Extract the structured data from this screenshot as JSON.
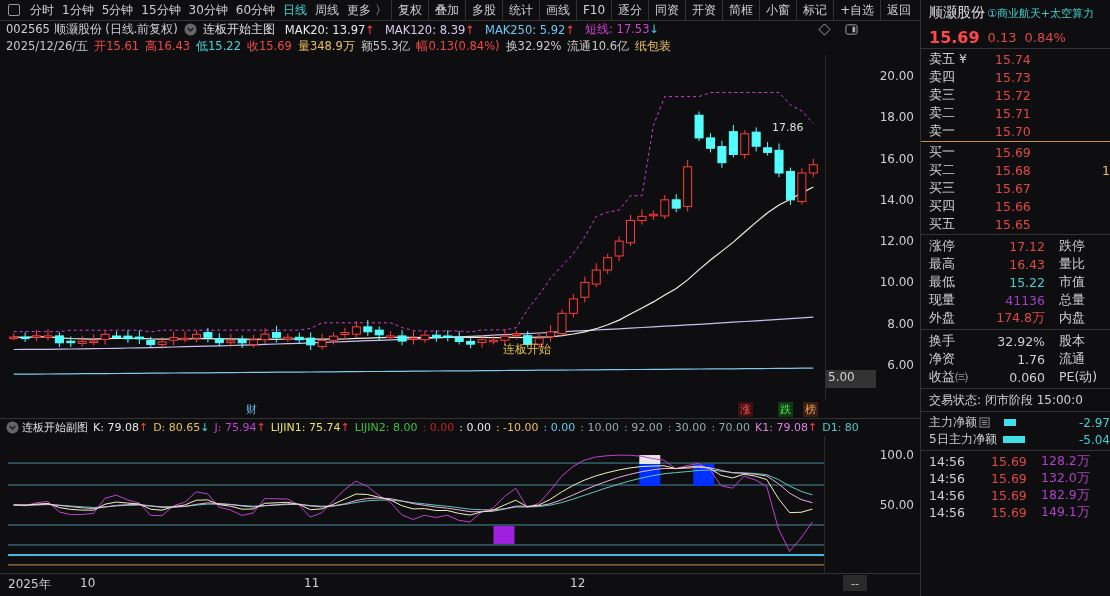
{
  "toolbar": {
    "periods": [
      {
        "label": "分时",
        "selected": false
      },
      {
        "label": "1分钟",
        "selected": false
      },
      {
        "label": "5分钟",
        "selected": false
      },
      {
        "label": "15分钟",
        "selected": false
      },
      {
        "label": "30分钟",
        "selected": false
      },
      {
        "label": "60分钟",
        "selected": false
      },
      {
        "label": "日线",
        "selected": true
      },
      {
        "label": "周线",
        "selected": false
      },
      {
        "label": "更多 〉",
        "selected": false
      }
    ],
    "buttons": [
      "复权",
      "叠加",
      "多股",
      "统计",
      "画线",
      "F10",
      "逐分",
      "同资",
      "开资",
      "简框",
      "小窗",
      "标记",
      "+自选",
      "返回"
    ]
  },
  "main_header": {
    "stock": "002565 顺灏股份 (日线.前复权)",
    "indicator": "连板开始主图",
    "values": [
      {
        "text": "MAK20: 13.97",
        "arrow": "↑",
        "color": "#e8e8e8"
      },
      {
        "text": "MAK120: 8.39",
        "arrow": "↑",
        "color": "#d8c8f0"
      },
      {
        "text": "MAK250: 5.92",
        "arrow": "↑",
        "color": "#6cc8f0"
      },
      {
        "text": "短线: 17.53",
        "arrow": "↓",
        "color": "#d040d8"
      }
    ]
  },
  "quote_line": [
    {
      "text": "2025/12/26/五",
      "color": "#c8c8c8"
    },
    {
      "text": "开15.61",
      "color": "#f04848"
    },
    {
      "text": "高16.43",
      "color": "#f04848"
    },
    {
      "text": "低15.22",
      "color": "#40d8d8"
    },
    {
      "text": "收15.69",
      "color": "#f04848"
    },
    {
      "text": "量348.9万",
      "color": "#e8c060"
    },
    {
      "text": "额55.3亿",
      "color": "#c8c8c8"
    },
    {
      "text": "幅0.13(0.84%)",
      "color": "#f04848"
    },
    {
      "text": "换32.92%",
      "color": "#c8c8c8"
    },
    {
      "text": "流通10.6亿",
      "color": "#c8c8c8"
    },
    {
      "text": "纸包装",
      "kind": "sector"
    }
  ],
  "price_chart": {
    "y_labels": [
      "20.00",
      "18.00",
      "16.00",
      "14.00",
      "12.00",
      "10.00",
      "8.00",
      "6.00"
    ],
    "current_label": "5.00",
    "high_label": "17.86",
    "signal_label": "连板开始"
  },
  "markers": [
    {
      "text": "财",
      "kind": "finance"
    },
    {
      "text": "涨",
      "kind": "up"
    },
    {
      "text": "跌",
      "kind": "down"
    },
    {
      "text": "榜",
      "kind": "list"
    }
  ],
  "sub_header": {
    "indicator": "连板开始副图",
    "values": [
      {
        "text": "K: 79.08",
        "arrow": "↑",
        "color": "#e8e8e8"
      },
      {
        "text": "D: 80.65",
        "arrow": "↓",
        "color": "#e0c050"
      },
      {
        "text": "J: 75.94",
        "arrow": "↑",
        "color": "#c040d0"
      },
      {
        "text": "LIJIN1: 75.74",
        "arrow": "↑",
        "color": "#e8e060"
      },
      {
        "text": "LIJIN2: 8.00",
        "color": "#40c040"
      },
      {
        "text": ": 0.00",
        "color": "#c02020"
      },
      {
        "text": ": 0.00",
        "color": "#e8e8e8"
      },
      {
        "text": ": -10.00",
        "color": "#e8c060"
      },
      {
        "text": ": 0.00",
        "color": "#60c8f0"
      },
      {
        "text": ": 10.00",
        "color": "#90a8b0"
      },
      {
        "text": ": 92.00",
        "color": "#90a8b0"
      },
      {
        "text": ": 30.00",
        "color": "#90a8b0"
      },
      {
        "text": ": 70.00",
        "color": "#90a8b0"
      },
      {
        "text": "K1: 79.08",
        "arrow": "↑",
        "color": "#e080e0"
      },
      {
        "text": "D1: 80",
        "color": "#50c8c8"
      }
    ]
  },
  "sub_chart": {
    "y_labels": [
      "100.0",
      "50.00"
    ]
  },
  "time_axis": [
    "2025年",
    "10",
    "11",
    "12"
  ],
  "time_axis_end": "--",
  "side": {
    "name": "顺灏股份",
    "tag": "①商业航天+太空算力",
    "price": "15.69",
    "change": "0.13",
    "change_pct": "0.84%",
    "asks": [
      {
        "label": "卖五 ¥",
        "price": "15.74"
      },
      {
        "label": "卖四",
        "price": "15.73"
      },
      {
        "label": "卖三",
        "price": "15.72"
      },
      {
        "label": "卖二",
        "price": "15.71"
      },
      {
        "label": "卖一",
        "price": "15.70"
      }
    ],
    "bids": [
      {
        "label": "买一",
        "price": "15.69"
      },
      {
        "label": "买二",
        "price": "15.68",
        "extra": "1"
      },
      {
        "label": "买三",
        "price": "15.67"
      },
      {
        "label": "买四",
        "price": "15.66"
      },
      {
        "label": "买五",
        "price": "15.65"
      }
    ],
    "stats": [
      {
        "label": "涨停",
        "value": "17.12",
        "color": "#e04848",
        "label2": "跌停"
      },
      {
        "label": "最高",
        "value": "16.43",
        "color": "#e04848",
        "label2": "量比"
      },
      {
        "label": "最低",
        "value": "15.22",
        "color": "#40d0d0",
        "label2": "市值"
      },
      {
        "label": "现量",
        "value": "41136",
        "color": "#a040c8",
        "label2": "总量"
      },
      {
        "label": "外盘",
        "value": "174.8万",
        "color": "#e04848",
        "label2": "内盘"
      }
    ],
    "stats2": [
      {
        "label": "换手",
        "value": "32.92%",
        "label2": "股本"
      },
      {
        "label": "净资",
        "value": "1.76",
        "label2": "流通"
      },
      {
        "label": "收益㈢",
        "value": "0.060",
        "label2": "PE(动)"
      }
    ],
    "status": "交易状态: 闭市阶段 15:00:0",
    "flows": [
      {
        "label": "主力净额",
        "value": "-2.97"
      },
      {
        "label": "5日主力净额",
        "value": "-5.04"
      }
    ],
    "ticks": [
      {
        "time": "14:56",
        "price": "15.69",
        "volume": "128.2万"
      },
      {
        "time": "14:56",
        "price": "15.69",
        "volume": "132.0万"
      },
      {
        "time": "14:56",
        "price": "15.69",
        "volume": "182.9万"
      },
      {
        "time": "14:56",
        "price": "15.69",
        "volume": "149.1万"
      }
    ]
  }
}
